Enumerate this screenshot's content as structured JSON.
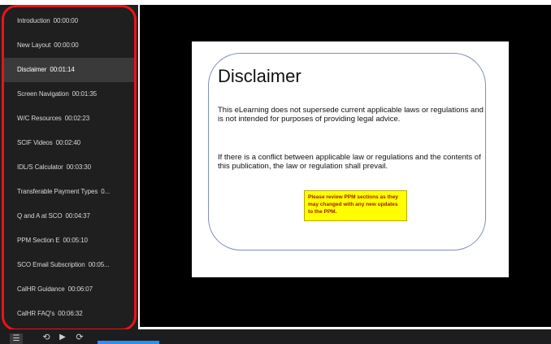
{
  "sidebar": {
    "items": [
      {
        "label": "Introduction",
        "time": "00:00:00"
      },
      {
        "label": "New Layout",
        "time": "00:00:00"
      },
      {
        "label": "Disclaimer",
        "time": "00:01:14"
      },
      {
        "label": "Screen Navigation",
        "time": "00:01:35"
      },
      {
        "label": "W/C Resources",
        "time": "00:02:23"
      },
      {
        "label": "SCIF Videos",
        "time": "00:02:40"
      },
      {
        "label": "IDL/S Calculator",
        "time": "00:03:30"
      },
      {
        "label": "Transferable Payment Types",
        "time": "0..."
      },
      {
        "label": "Q and A at SCO",
        "time": "00:04:37"
      },
      {
        "label": "PPM Section E",
        "time": "00:05:10"
      },
      {
        "label": "SCO Email Subscription",
        "time": "00:05..."
      },
      {
        "label": "CalHR Guidance",
        "time": "00:06:07"
      },
      {
        "label": "CalHR FAQ's",
        "time": "00:06:32"
      }
    ],
    "active_index": 2,
    "highlight_color": "#e8141c"
  },
  "slide": {
    "title": "Disclaimer",
    "paragraph1": "This eLearning does not supersede current applicable laws or regulations and is not intended for purposes of providing legal advice.",
    "paragraph2": "If there is a conflict between applicable law or regulations and the contents of this publication, the law or regulation shall prevail.",
    "note": "Please review PPM sections as they may changed with any new updates to the PPM."
  },
  "controls": {
    "menu_icon": "menu-icon",
    "prev_icon": "rewind-icon",
    "play_icon": "play-icon",
    "next_icon": "forward-icon",
    "progress_color": "#2d8ff0"
  }
}
